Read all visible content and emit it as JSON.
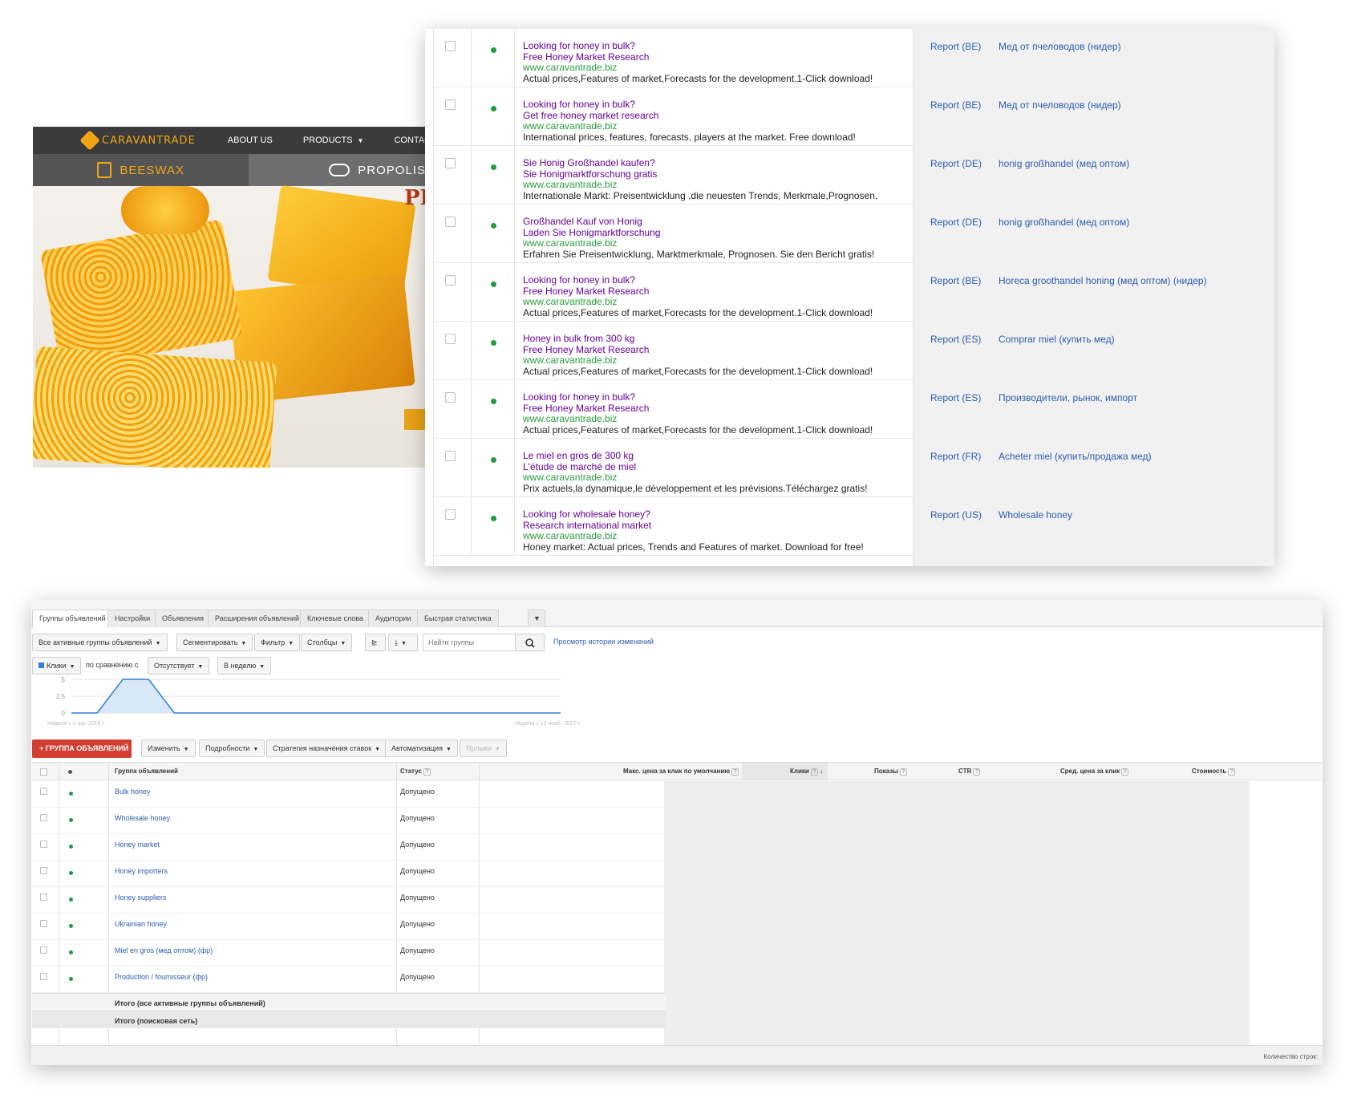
{
  "site": {
    "logo_text": "CARAVANTRADE",
    "nav": [
      {
        "label": "ABOUT US",
        "has_caret": false
      },
      {
        "label": "PRODUCTS",
        "has_caret": true
      },
      {
        "label": "CONTACT",
        "has_caret": false
      }
    ],
    "categories": [
      "BEESWAX",
      "PROPOLIS"
    ],
    "heading_fragment": "PR",
    "brand_color": "#f0a516"
  },
  "ads": {
    "rows": [
      {
        "headline1": "Looking for honey in bulk?",
        "headline2": "Free Honey Market Research",
        "url": "www.caravantrade.biz",
        "description": "Actual prices,Features of market,Forecasts for the development.1-Click download!",
        "campaign": "Report (BE)",
        "ad_group": "Мед от пчеловодов (нидер)"
      },
      {
        "headline1": "Looking for honey in bulk?",
        "headline2": "Get free honey market research",
        "url": "www.caravantrade.biz",
        "description": "International prices, features, forecasts, players at the market. Free download!",
        "campaign": "Report (BE)",
        "ad_group": "Мед от пчеловодов (нидер)"
      },
      {
        "headline1": "Sie Honig Großhandel kaufen?",
        "headline2": "Sie Honigmarktforschung gratis",
        "url": "www.caravantrade.biz",
        "description": "Internationale Markt: Preisentwicklung ,die neuesten Trends, Merkmale,Prognosen.",
        "campaign": "Report (DE)",
        "ad_group": "honig großhandel (мед оптом)"
      },
      {
        "headline1": "Großhandel Kauf von Honig",
        "headline2": "Laden Sie Honigmarktforschung",
        "url": "www.caravantrade.biz",
        "description": "Erfahren Sie Preisentwicklung, Marktmerkmale, Prognosen. Sie den Bericht gratis!",
        "campaign": "Report (DE)",
        "ad_group": "honig großhandel (мед оптом)"
      },
      {
        "headline1": "Looking for honey in bulk?",
        "headline2": "Free Honey Market Research",
        "url": "www.caravantrade.biz",
        "description": "Actual prices,Features of market,Forecasts for the development.1-Click download!",
        "campaign": "Report (BE)",
        "ad_group": "Horeca groothandel honing (мед оптом) (нидер)"
      },
      {
        "headline1": "Honey in bulk from 300 kg",
        "headline2": "Free Honey Market Research",
        "url": "www.caravantrade.biz",
        "description": "Actual prices,Features of market,Forecasts for the development.1-Click download!",
        "campaign": "Report (ES)",
        "ad_group": "Comprar miel (купить мед)"
      },
      {
        "headline1": "Looking for honey in bulk?",
        "headline2": "Free Honey Market Research",
        "url": "www.caravantrade.biz",
        "description": "Actual prices,Features of market,Forecasts for the development.1-Click download!",
        "campaign": "Report (ES)",
        "ad_group": "Производители, рынок, импорт"
      },
      {
        "headline1": "Le miel en gros de 300 kg",
        "headline2": "L'étude de marché de miel",
        "url": "www.caravantrade.biz",
        "description": "Prix actuels,la dynamique,le développement et les prévisions.Téléchargez gratis!",
        "campaign": "Report (FR)",
        "ad_group": "Acheter miel (купить/продажа мед)"
      },
      {
        "headline1": "Looking for wholesale honey?",
        "headline2": "Research international market",
        "url": "www.caravantrade.biz",
        "description": "Honey market: Actual prices, Trends and Features of market. Download for free!",
        "campaign": "Report (US)",
        "ad_group": "Wholesale honey"
      }
    ]
  },
  "adwords": {
    "tabs": [
      "Группы объявлений",
      "Настройки",
      "Объявления",
      "Расширения объявлений",
      "Ключевые слова",
      "Аудитории",
      "Быстрая статистика"
    ],
    "active_tab": 0,
    "toolbar": {
      "filter_active": "Все активные группы объявлений",
      "segment": "Сегментировать",
      "filter": "Фильтр",
      "columns": "Столбцы",
      "search_placeholder": "Найти группы",
      "history_link": "Просмотр истории изменений"
    },
    "compare": {
      "metric": "Клики",
      "compare_label": "по сравнению с",
      "compare_value": "Отсутствует",
      "period": "В неделю"
    },
    "chart_labels": {
      "start": "Неделя с 1 авг. 2016 г.",
      "end": "Неделя с 13 нояб. 2017 г."
    },
    "actions": {
      "add_group": "ГРУППА ОБЪЯВЛЕНИЙ",
      "edit": "Изменить",
      "details": "Подробности",
      "bid_strategy": "Стратегия назначения ставок",
      "automation": "Автоматизация",
      "labels": "Ярлыки"
    },
    "columns": {
      "group": "Группа объявлений",
      "status": "Статус",
      "max_cpc": "Макс. цена за клик по умолчанию",
      "clicks": "Клики",
      "impressions": "Показы",
      "ctr": "CTR",
      "avg_cpc": "Сред. цена за клик",
      "cost": "Стоимость"
    },
    "rows": [
      {
        "name": "Bulk honey",
        "status": "Допущено"
      },
      {
        "name": "Wholesale honey",
        "status": "Допущено"
      },
      {
        "name": "Honey market",
        "status": "Допущено"
      },
      {
        "name": "Honey importers",
        "status": "Допущено"
      },
      {
        "name": "Honey suppliers",
        "status": "Допущено"
      },
      {
        "name": "Ukrainian honey",
        "status": "Допущено"
      },
      {
        "name": "Miel en gros (мед оптом) (фр)",
        "status": "Допущено"
      },
      {
        "name": "Production / fournisseur (фр)",
        "status": "Допущено"
      }
    ],
    "totals": {
      "active": "Итого (все активные группы объявлений)",
      "search": "Итого (поисковая сеть)"
    },
    "footer": "Количество строк:",
    "accent_red": "#d23f31",
    "link_blue": "#2a5db0"
  },
  "chart_data": {
    "type": "area",
    "title": "",
    "series": [
      {
        "name": "Клики",
        "values": [
          0,
          0,
          5,
          5,
          0,
          0,
          0,
          0,
          0,
          0,
          0,
          0,
          0,
          0,
          0,
          0,
          0,
          0,
          0,
          0
        ]
      }
    ],
    "ylim": [
      0,
      5
    ],
    "yticks": [
      "0",
      "2.5",
      "5"
    ],
    "x_start_label": "Неделя с 1 авг. 2016 г.",
    "x_end_label": "Неделя с 13 нояб. 2017 г.",
    "grid": true,
    "color": "#2f7ed8"
  }
}
